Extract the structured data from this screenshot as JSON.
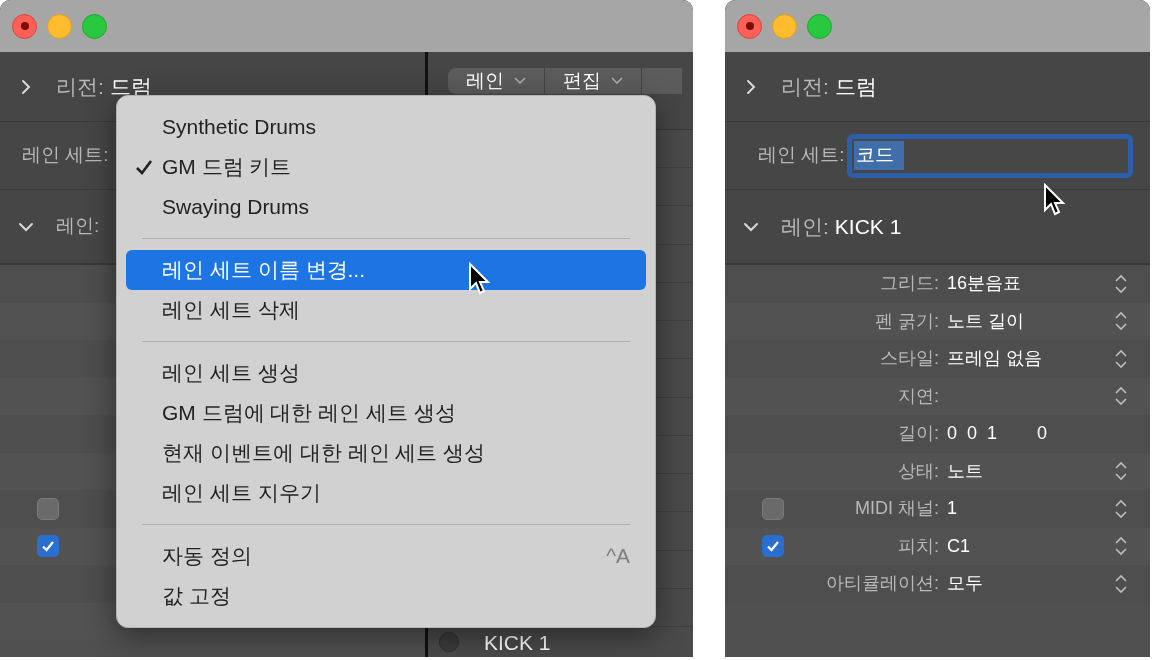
{
  "left_window": {
    "region": {
      "label": "리전:",
      "value": "드럼"
    },
    "lane_set": {
      "label": "레인 세트:"
    },
    "lane": {
      "label": "레인:"
    },
    "checkboxes": [
      {
        "checked": false
      },
      {
        "checked": true
      }
    ],
    "tabs": [
      {
        "label": "레인"
      },
      {
        "label": "편집"
      }
    ],
    "lane_row": {
      "name": "KICK 1"
    },
    "menu": [
      {
        "kind": "item",
        "label": "Synthetic Drums",
        "checked": false,
        "selected": false
      },
      {
        "kind": "item",
        "label": "GM 드럼 키트",
        "checked": true,
        "selected": false
      },
      {
        "kind": "item",
        "label": "Swaying Drums",
        "checked": false,
        "selected": false
      },
      {
        "kind": "separator"
      },
      {
        "kind": "item",
        "label": "레인 세트 이름 변경...",
        "checked": false,
        "selected": true
      },
      {
        "kind": "item",
        "label": "레인 세트 삭제",
        "checked": false,
        "selected": false
      },
      {
        "kind": "separator"
      },
      {
        "kind": "item",
        "label": "레인 세트 생성",
        "checked": false,
        "selected": false
      },
      {
        "kind": "item",
        "label": "GM 드럼에 대한 레인 세트 생성",
        "checked": false,
        "selected": false
      },
      {
        "kind": "item",
        "label": "현재 이벤트에 대한 레인 세트 생성",
        "checked": false,
        "selected": false
      },
      {
        "kind": "item",
        "label": "레인 세트 지우기",
        "checked": false,
        "selected": false
      },
      {
        "kind": "separator"
      },
      {
        "kind": "item",
        "label": "자동 정의",
        "checked": false,
        "selected": false,
        "shortcut": "^A"
      },
      {
        "kind": "item",
        "label": "값 고정",
        "checked": false,
        "selected": false
      }
    ]
  },
  "right_window": {
    "region": {
      "label": "리전:",
      "value": "드럼"
    },
    "lane_set": {
      "label": "레인 세트:",
      "value": "코드"
    },
    "lane": {
      "label": "레인:",
      "value": "KICK 1"
    },
    "params": [
      {
        "label": "그리드:",
        "value": "16분음표",
        "stepper": true
      },
      {
        "label": "펜 굵기:",
        "value": "노트 길이",
        "stepper": true
      },
      {
        "label": "스타일:",
        "value": "프레임 없음",
        "stepper": true
      },
      {
        "label": "지연:",
        "stepper": true
      },
      {
        "label": "길이:",
        "segments": [
          "0",
          "0",
          "1",
          "0"
        ],
        "stepper": false
      },
      {
        "label": "상태:",
        "value": "노트",
        "stepper": true
      },
      {
        "label": "MIDI 채널:",
        "value": "1",
        "stepper": true,
        "checked": false
      },
      {
        "label": "피치:",
        "value": "C1",
        "stepper": true,
        "checked": true
      },
      {
        "label": "아티큘레이션:",
        "value": "모두",
        "stepper": true
      }
    ]
  }
}
